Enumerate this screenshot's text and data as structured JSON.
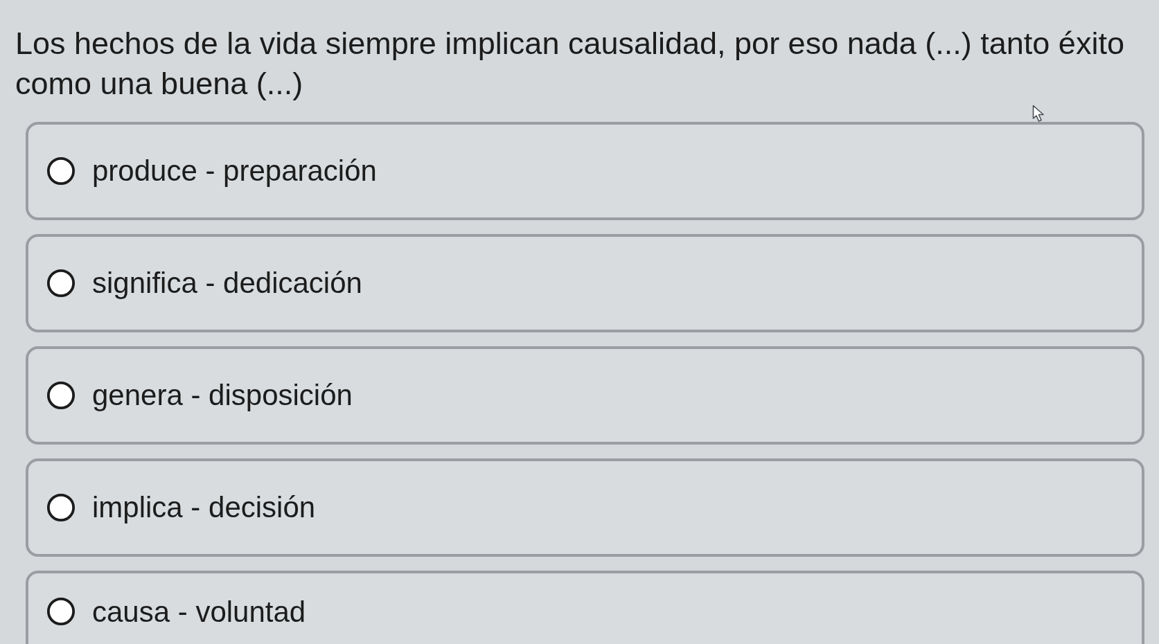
{
  "question": {
    "text": "Los hechos de la vida siempre implican causalidad, por eso nada (...) tanto éxito como una buena (...)"
  },
  "options": [
    {
      "label": "produce - preparación",
      "selected": false
    },
    {
      "label": "significa - dedicación",
      "selected": false
    },
    {
      "label": "genera - disposición",
      "selected": false
    },
    {
      "label": "implica - decisión",
      "selected": false
    },
    {
      "label": "causa - voluntad",
      "selected": false
    }
  ]
}
